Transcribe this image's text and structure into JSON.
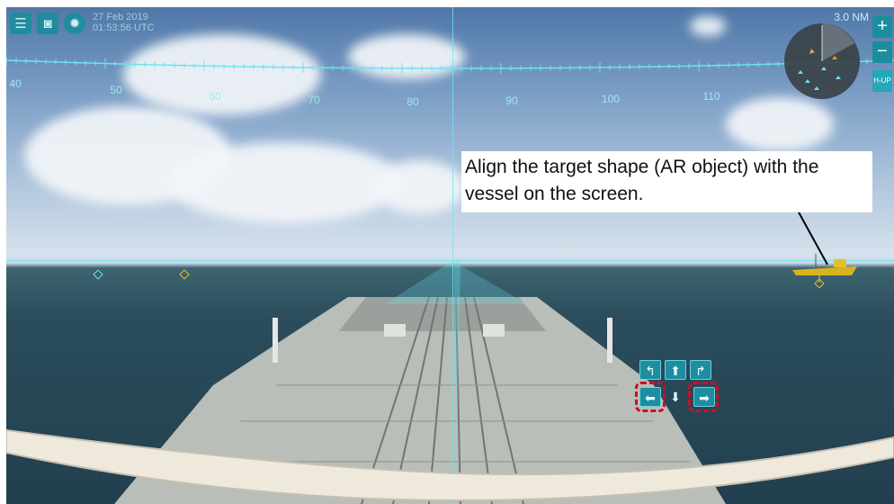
{
  "toolbar": {
    "menu_icon": "menu-icon",
    "camera_icon": "camera-icon",
    "settings_icon": "gear-icon"
  },
  "datetime": {
    "date": "27 Feb 2019",
    "time": "01:53:56 UTC"
  },
  "bearing_scale": {
    "labels": [
      "40",
      "50",
      "60",
      "70",
      "80",
      "90",
      "100",
      "110"
    ]
  },
  "radar": {
    "range": "3.0 NM",
    "zoom_in": "+",
    "zoom_out": "−",
    "orientation": "H-UP"
  },
  "callout": {
    "text": "Align the target shape (AR object) with the vessel on the screen."
  },
  "adjust_controls": {
    "rotate_left": "↰",
    "up": "⬆",
    "rotate_right": "↱",
    "left": "⬅",
    "down": "⬇",
    "right": "➡"
  },
  "colors": {
    "overlay": "#6fe2f0",
    "button": "#1b8e9e",
    "highlight": "#c8102e",
    "target_marker": "#e0c040"
  }
}
